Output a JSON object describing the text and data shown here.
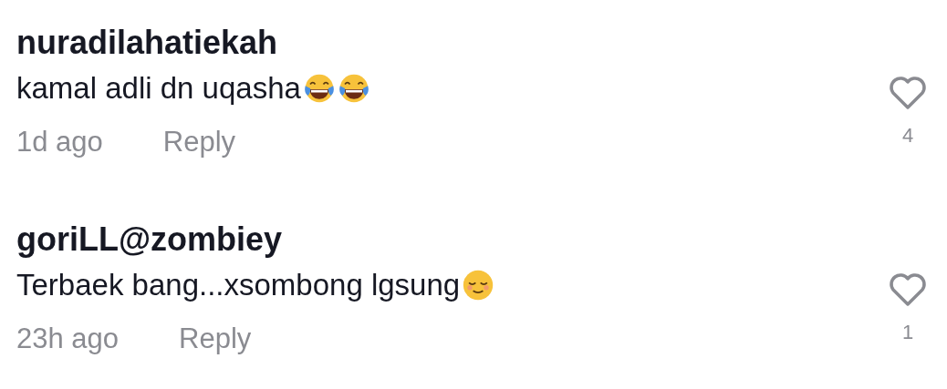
{
  "comments": [
    {
      "username": "nuradilahatiekah",
      "text": "kamal adli dn uqasha",
      "emojis": [
        {
          "kind": "laugh"
        },
        {
          "kind": "laugh"
        }
      ],
      "time": "1d ago",
      "reply": "Reply",
      "likes": "4",
      "liked": false
    },
    {
      "username": "goriLL@zombiey",
      "text": "Terbaek bang...xsombong lgsung",
      "emojis": [
        {
          "kind": "relieved"
        }
      ],
      "time": "23h ago",
      "reply": "Reply",
      "likes": "1",
      "liked": false
    }
  ]
}
